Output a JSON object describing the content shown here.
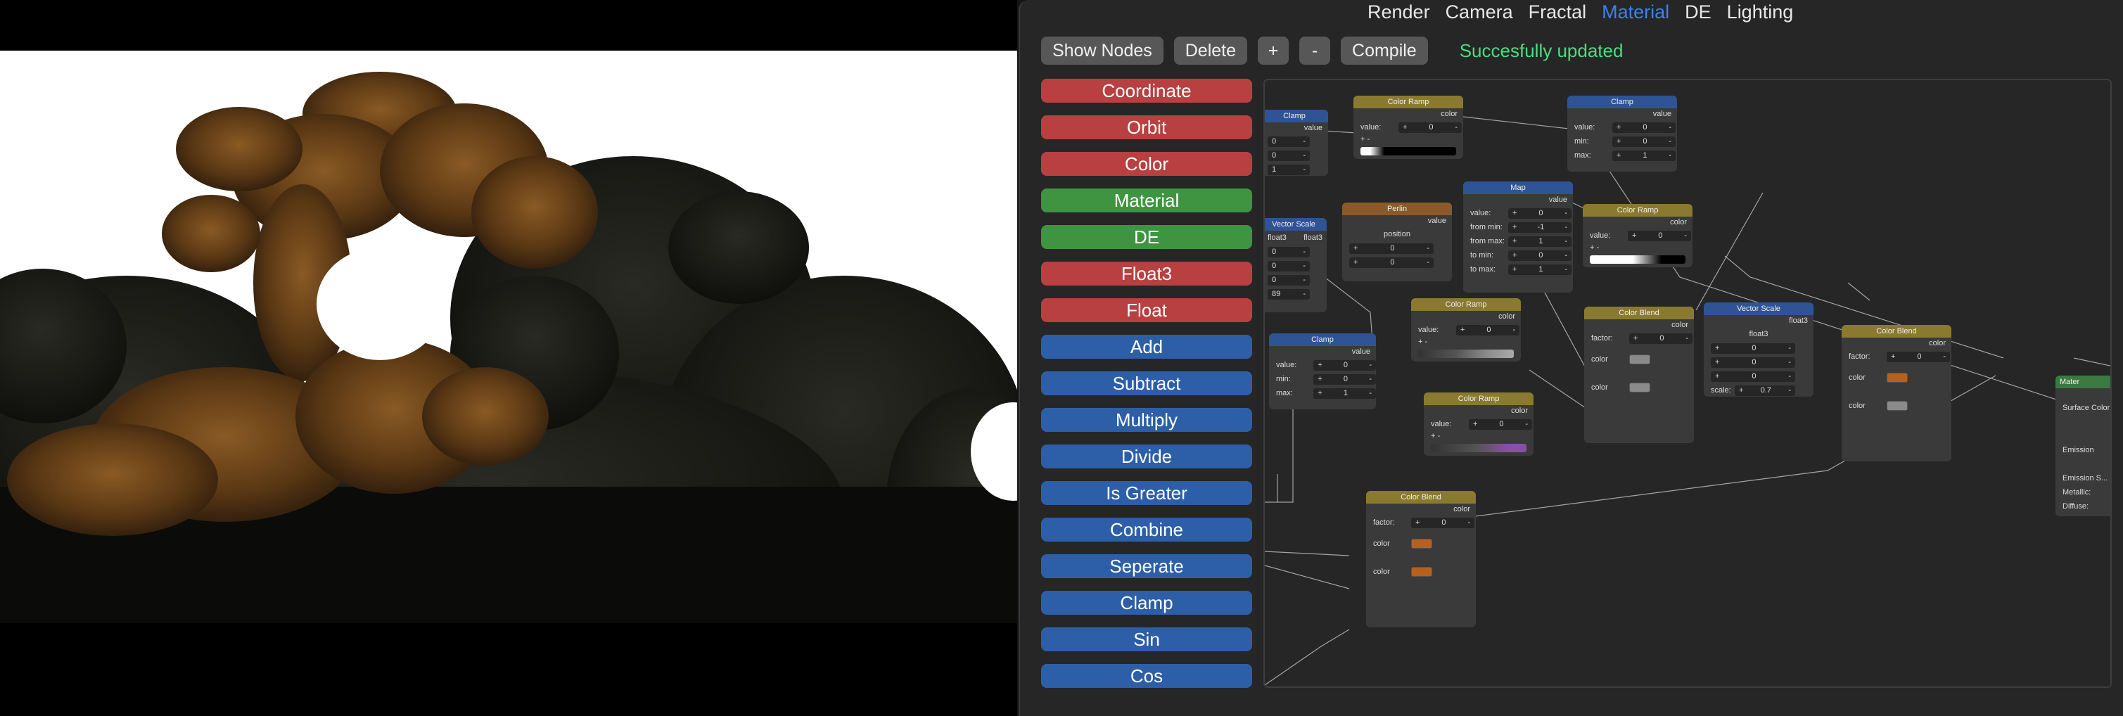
{
  "tabs": [
    "Render",
    "Camera",
    "Fractal",
    "Material",
    "DE",
    "Lighting"
  ],
  "active_tab": "Material",
  "toolbar": {
    "show_nodes": "Show Nodes",
    "delete": "Delete",
    "plus": "+",
    "minus": "-",
    "compile": "Compile",
    "status": "Succesfully updated"
  },
  "palette": [
    {
      "label": "Coordinate",
      "color": "red"
    },
    {
      "label": "Orbit",
      "color": "red"
    },
    {
      "label": "Color",
      "color": "red"
    },
    {
      "label": "Material",
      "color": "green"
    },
    {
      "label": "DE",
      "color": "green"
    },
    {
      "label": "Float3",
      "color": "red"
    },
    {
      "label": "Float",
      "color": "red"
    },
    {
      "label": "Add",
      "color": "blue"
    },
    {
      "label": "Subtract",
      "color": "blue"
    },
    {
      "label": "Multiply",
      "color": "blue"
    },
    {
      "label": "Divide",
      "color": "blue"
    },
    {
      "label": "Is Greater",
      "color": "blue"
    },
    {
      "label": "Combine",
      "color": "blue"
    },
    {
      "label": "Seperate",
      "color": "blue"
    },
    {
      "label": "Clamp",
      "color": "blue"
    },
    {
      "label": "Sin",
      "color": "blue"
    },
    {
      "label": "Cos",
      "color": "blue"
    }
  ],
  "nodes": {
    "clamp_a": {
      "title": "Clamp",
      "out": "value",
      "rows": [
        [
          "",
          "0"
        ],
        [
          "",
          "0"
        ],
        [
          "",
          "1"
        ]
      ]
    },
    "color_ramp_a": {
      "title": "Color Ramp",
      "out": "color",
      "rows": [
        [
          "value:",
          "0"
        ]
      ]
    },
    "clamp_b": {
      "title": "Clamp",
      "out": "value",
      "rows": [
        [
          "value:",
          "0"
        ],
        [
          "min:",
          "0"
        ],
        [
          "max:",
          "1"
        ]
      ]
    },
    "vector_scale_a": {
      "title": "Vector Scale",
      "out": "float3",
      "sub": "float3",
      "rows": [
        [
          "",
          "0"
        ],
        [
          "",
          "0"
        ],
        [
          "",
          "0"
        ],
        [
          "",
          "89"
        ]
      ]
    },
    "perlin": {
      "title": "Perlin",
      "out": "value",
      "sub": "position",
      "rows": [
        [
          "",
          "0"
        ],
        [
          "",
          "0"
        ],
        [
          "",
          "0"
        ]
      ]
    },
    "map": {
      "title": "Map",
      "out": "value",
      "rows": [
        [
          "value:",
          "0"
        ],
        [
          "from min:",
          "-1"
        ],
        [
          "from max:",
          "1"
        ],
        [
          "to min:",
          "0"
        ],
        [
          "to max:",
          "1"
        ]
      ]
    },
    "color_ramp_b": {
      "title": "Color Ramp",
      "out": "color",
      "rows": [
        [
          "value:",
          "0"
        ]
      ]
    },
    "clamp_c": {
      "title": "Clamp",
      "out": "value",
      "rows": [
        [
          "value:",
          "0"
        ],
        [
          "min:",
          "0"
        ],
        [
          "max:",
          "1"
        ]
      ]
    },
    "color_ramp_c": {
      "title": "Color Ramp",
      "out": "color",
      "rows": [
        [
          "value:",
          "0"
        ]
      ]
    },
    "color_ramp_d": {
      "title": "Color Ramp",
      "out": "color",
      "rows": [
        [
          "value:",
          "0"
        ]
      ]
    },
    "color_blend_a": {
      "title": "Color Blend",
      "out": "color",
      "rows": [
        [
          "factor:",
          "0"
        ]
      ]
    },
    "vector_scale_b": {
      "title": "Vector Scale",
      "out": "float3",
      "sub": "float3",
      "rows": [
        [
          "",
          "0"
        ],
        [
          "",
          "0"
        ],
        [
          "",
          "0"
        ],
        [
          "scale:",
          "0.7"
        ]
      ]
    },
    "color_blend_b": {
      "title": "Color Blend",
      "out": "color",
      "rows": [
        [
          "factor:",
          "0"
        ]
      ]
    },
    "color_blend_c": {
      "title": "Color Blend",
      "out": "color",
      "rows": [
        [
          "factor:",
          "0"
        ]
      ]
    },
    "material": {
      "title": "Mater",
      "rows": [
        "Surface Color",
        "Emission",
        "Emission S...",
        "Metallic:",
        "Diffuse:"
      ]
    }
  },
  "labels": {
    "color": "color",
    "plus": "+",
    "minus": "-"
  },
  "colors": {
    "accent": "#3b82f6",
    "status": "#4ade80",
    "swatch_orange": "#b8601e",
    "swatch_grey": "#8a8a8a",
    "ramp_purple": "#8a4fa8"
  }
}
